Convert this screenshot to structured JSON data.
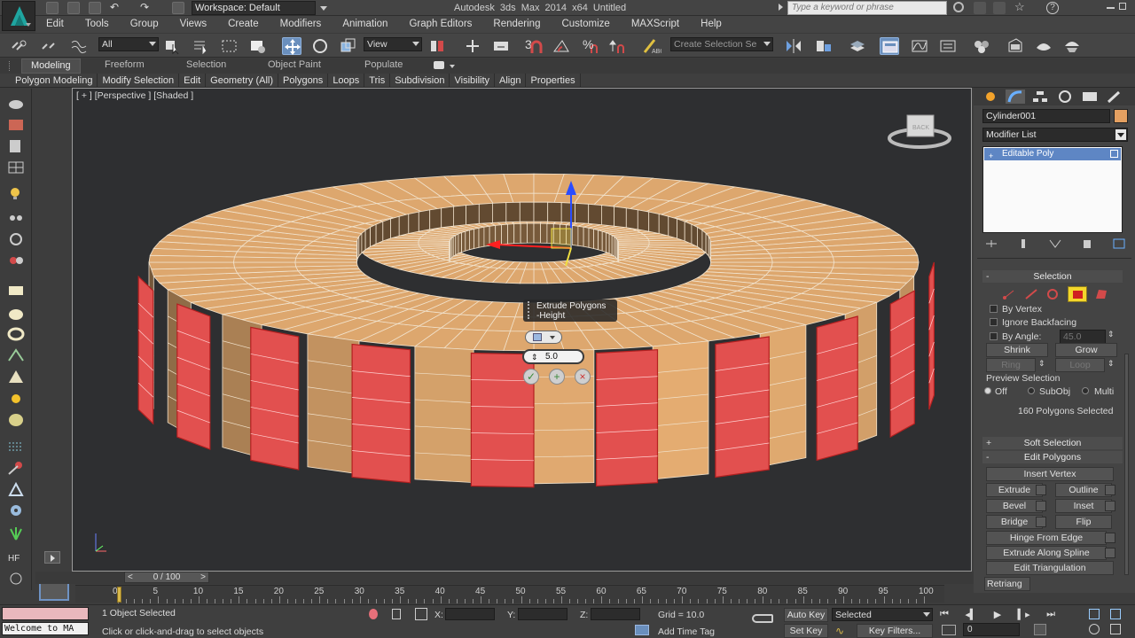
{
  "titlebar": {
    "workspace": "Workspace: Default",
    "title": "Autodesk 3ds Max  2014 x64     Untitled",
    "search_placeholder": "Type a keyword or phrase"
  },
  "menu": [
    "Edit",
    "Tools",
    "Group",
    "Views",
    "Create",
    "Modifiers",
    "Animation",
    "Graph Editors",
    "Rendering",
    "Customize",
    "MAXScript",
    "Help"
  ],
  "toolbar": {
    "selection_filter": "All",
    "ref_coord": "View",
    "snap_label": "3",
    "named_selection": "Create Selection Se",
    "active_tool": "select-and-move"
  },
  "ribbon": {
    "tabs": [
      "Modeling",
      "Freeform",
      "Selection",
      "Object Paint",
      "Populate"
    ],
    "active_tab": "Modeling",
    "panels": [
      "Polygon Modeling",
      "Modify Selection",
      "Edit",
      "Geometry (All)",
      "Polygons",
      "Loops",
      "Tris",
      "Subdivision",
      "Visibility",
      "Align",
      "Properties"
    ]
  },
  "viewport": {
    "label": "[ + ] [Perspective ] [Shaded ]",
    "caddy": {
      "title_line1": "Extrude Polygons",
      "title_line2": "-Height",
      "value": "5.0"
    },
    "colors": {
      "object": "#d9a46c",
      "selected": "#e2504f",
      "background": "#2e2f31"
    }
  },
  "cmdpanel": {
    "object_name": "Cylinder001",
    "object_color": "#e4a061",
    "modifier_list": "Modifier List",
    "stack": [
      "Editable Poly"
    ],
    "selection": {
      "title": "Selection",
      "by_vertex": "By Vertex",
      "ignore_backfacing": "Ignore Backfacing",
      "by_angle": "By Angle:",
      "angle_value": "45.0",
      "shrink": "Shrink",
      "grow": "Grow",
      "ring": "Ring",
      "loop": "Loop",
      "preview": "Preview Selection",
      "preview_off": "Off",
      "preview_subobj": "SubObj",
      "preview_multi": "Multi",
      "status": "160 Polygons Selected"
    },
    "soft_selection": "Soft Selection",
    "edit_polygons": {
      "title": "Edit Polygons",
      "insert_vertex": "Insert Vertex",
      "extrude": "Extrude",
      "outline": "Outline",
      "bevel": "Bevel",
      "inset": "Inset",
      "bridge": "Bridge",
      "flip": "Flip",
      "hinge": "Hinge From Edge",
      "extrude_spline": "Extrude Along Spline",
      "edit_tri": "Edit Triangulation",
      "retriangulate": "Retriang"
    }
  },
  "timeline": {
    "frame_display": "0 / 100",
    "ticks": [
      0,
      5,
      10,
      15,
      20,
      25,
      30,
      35,
      40,
      45,
      50,
      55,
      60,
      65,
      70,
      75,
      80,
      85,
      90,
      95,
      100
    ]
  },
  "status": {
    "maxscript_listener": "Welcome to MA",
    "selected_count": "1 Object Selected",
    "prompt": "Click or click-and-drag to select objects",
    "x_label": "X:",
    "y_label": "Y:",
    "z_label": "Z:",
    "grid": "Grid = 10.0",
    "add_time_tag": "Add Time Tag",
    "auto_key": "Auto Key",
    "auto_key_sel": "Selected",
    "set_key": "Set Key",
    "key_filters": "Key Filters...",
    "current_frame": "0"
  }
}
